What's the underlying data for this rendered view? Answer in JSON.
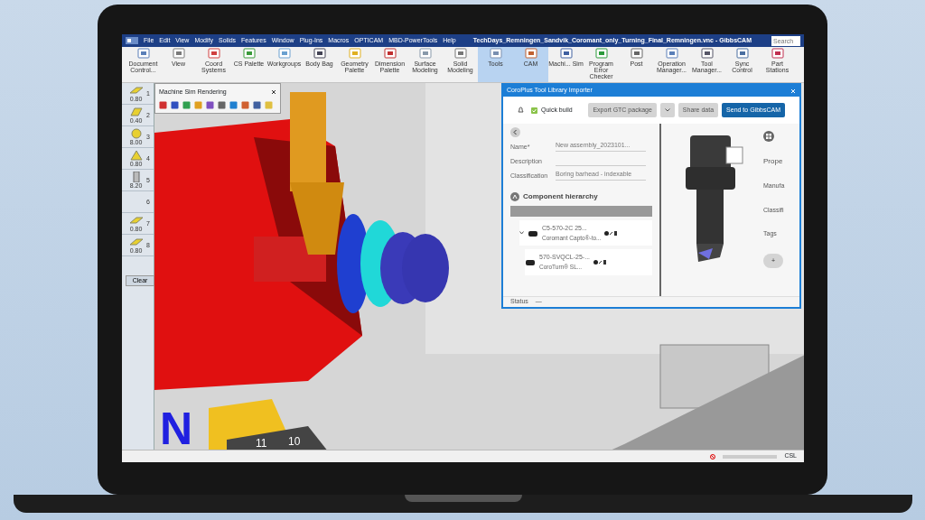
{
  "app": {
    "title": "TechDays_Remningen_Sandvik_Coromant_only_Turning_Final_Remningen.vnc - GibbsCAM",
    "search": {
      "placeholder": "Search"
    }
  },
  "menu": [
    "File",
    "Edit",
    "View",
    "Modify",
    "Solids",
    "Features",
    "Window",
    "Plug-Ins",
    "Macros",
    "OPTICAM",
    "MBD-PowerTools",
    "Help"
  ],
  "toolbar": [
    {
      "label": "Document Control...",
      "selected": false
    },
    {
      "label": "View",
      "selected": false
    },
    {
      "label": "Coord Systems",
      "selected": false
    },
    {
      "label": "CS Palette",
      "selected": false
    },
    {
      "label": "Workgroups",
      "selected": false
    },
    {
      "label": "Body Bag",
      "selected": false
    },
    {
      "label": "Geometry Palette",
      "selected": false
    },
    {
      "label": "Dimension Palette",
      "selected": false
    },
    {
      "label": "Surface Modeling",
      "selected": false
    },
    {
      "label": "Solid Modeling",
      "selected": false
    },
    {
      "label": "Tools",
      "selected": true
    },
    {
      "label": "CAM",
      "selected": true
    },
    {
      "label": "Machi... Sim",
      "selected": false
    },
    {
      "label": "Program Error Checker",
      "selected": false
    },
    {
      "label": "Post",
      "selected": false
    },
    {
      "label": "Operation Manager...",
      "selected": false
    },
    {
      "label": "Tool Manager...",
      "selected": false
    },
    {
      "label": "Sync Control",
      "selected": false
    },
    {
      "label": "Part Stations",
      "selected": false
    }
  ],
  "tool_list": {
    "tools": [
      {
        "kind": "diamond",
        "value": "0.80",
        "number": "1"
      },
      {
        "kind": "rhombus",
        "value": "0.40",
        "number": "2"
      },
      {
        "kind": "round",
        "value": "8.00",
        "number": "3"
      },
      {
        "kind": "triangle",
        "value": "0.80",
        "number": "4"
      },
      {
        "kind": "drill",
        "value": "8.20",
        "number": "5"
      },
      {
        "kind": "empty",
        "number": "6"
      },
      {
        "kind": "diamond",
        "value": "0.80",
        "number": "7"
      },
      {
        "kind": "diamond",
        "value": "0.80",
        "number": "8"
      }
    ],
    "clear_button": "Clear"
  },
  "sim_panel": {
    "title": "Machine Sim Rendering"
  },
  "viewport": {
    "labels": [
      "N",
      "11",
      "10"
    ]
  },
  "dialog": {
    "title": "CoroPlus Tool Library Importer",
    "quick_build": {
      "label": "Quick build",
      "checked": true
    },
    "buttons": [
      "Export GTC package",
      "Share data",
      "Send to GibbsCAM"
    ],
    "fields": [
      {
        "label": "Name*",
        "value": "New assembly_2023101..."
      },
      {
        "label": "Description"
      },
      {
        "label": "Classification",
        "value": "Boring barhead - indexable"
      }
    ],
    "hierarchy_title": "Component hierarchy",
    "hierarchy": [
      {
        "name": "C5-570-2C 25...",
        "detail": "Coromant Capto®-to...",
        "expanded": true,
        "children": [
          {
            "name": "570-SVQCL-25-...",
            "detail": "CoroTurn® SL..."
          }
        ]
      }
    ],
    "properties": [
      "Prope",
      "Manufa",
      "Classifi",
      "Tags"
    ],
    "tags_add": "+",
    "status": {
      "label": "Status",
      "value": "—"
    }
  },
  "status_bar": {
    "text": "CSL"
  }
}
